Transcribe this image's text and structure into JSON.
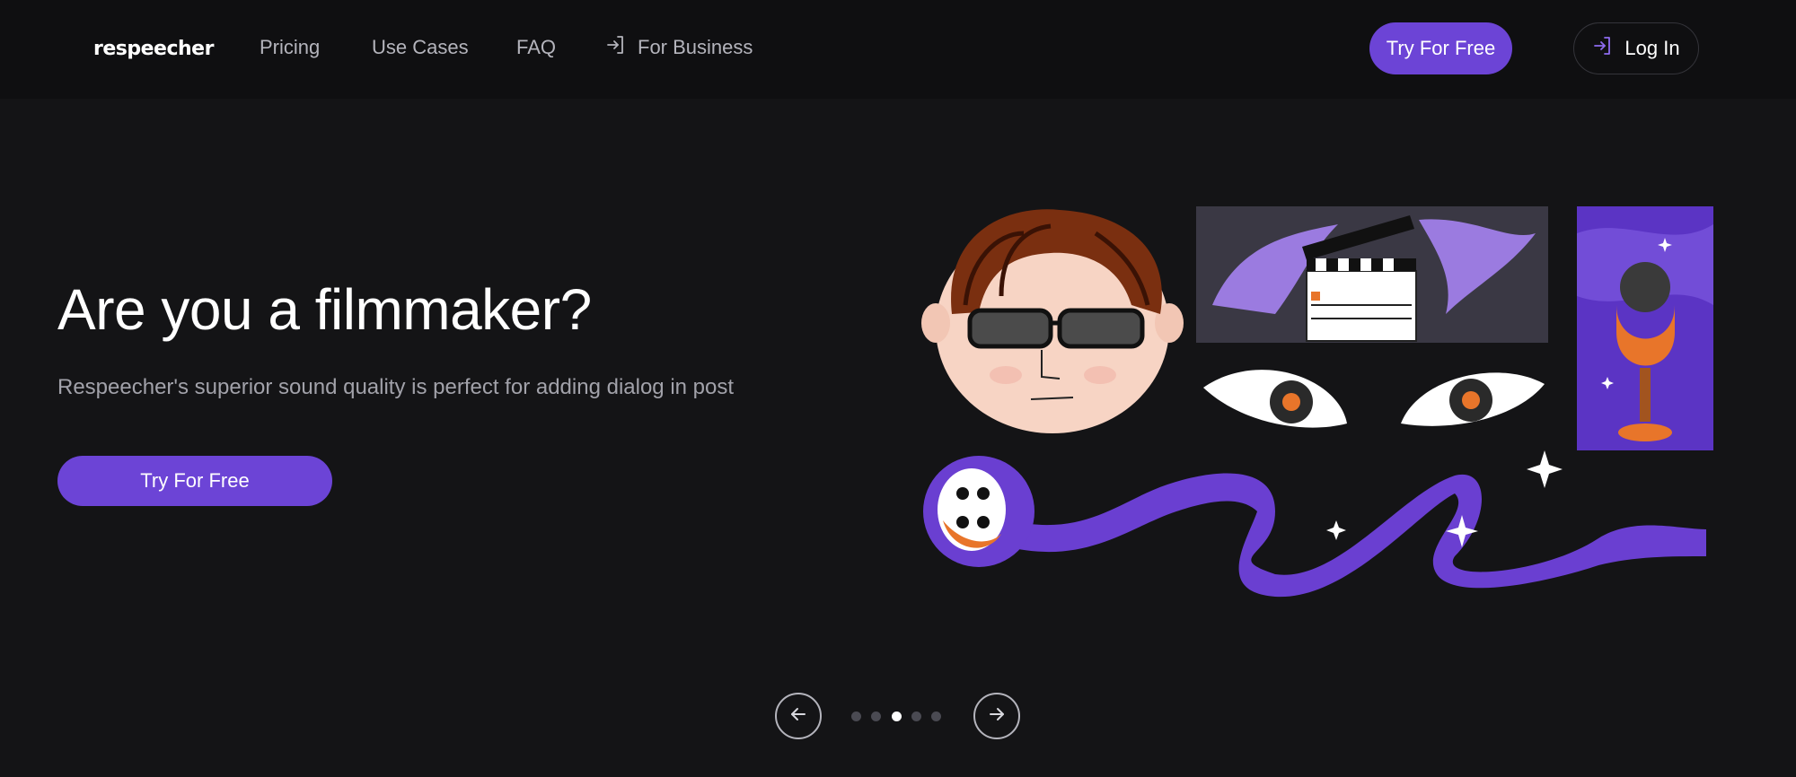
{
  "header": {
    "logo": "respeecher",
    "nav": {
      "pricing": "Pricing",
      "use_cases": "Use Cases",
      "faq": "FAQ",
      "for_business": "For Business"
    },
    "try_free_label": "Try For Free",
    "login_label": "Log In"
  },
  "hero": {
    "title": "Are you a filmmaker?",
    "subtitle": "Respeecher's superior sound quality is perfect for adding dialog in post",
    "cta_label": "Try For Free"
  },
  "carousel": {
    "slide_count": 5,
    "active_slide": 3
  },
  "colors": {
    "background": "#141416",
    "nav_background": "#0f0f11",
    "accent": "#6c44d6",
    "illustration_purple": "#6a3fd1",
    "illustration_orange": "#e8752a"
  },
  "icons": {
    "business": "login-arrow-icon",
    "login": "login-arrow-icon",
    "prev": "arrow-left-icon",
    "next": "arrow-right-icon"
  }
}
